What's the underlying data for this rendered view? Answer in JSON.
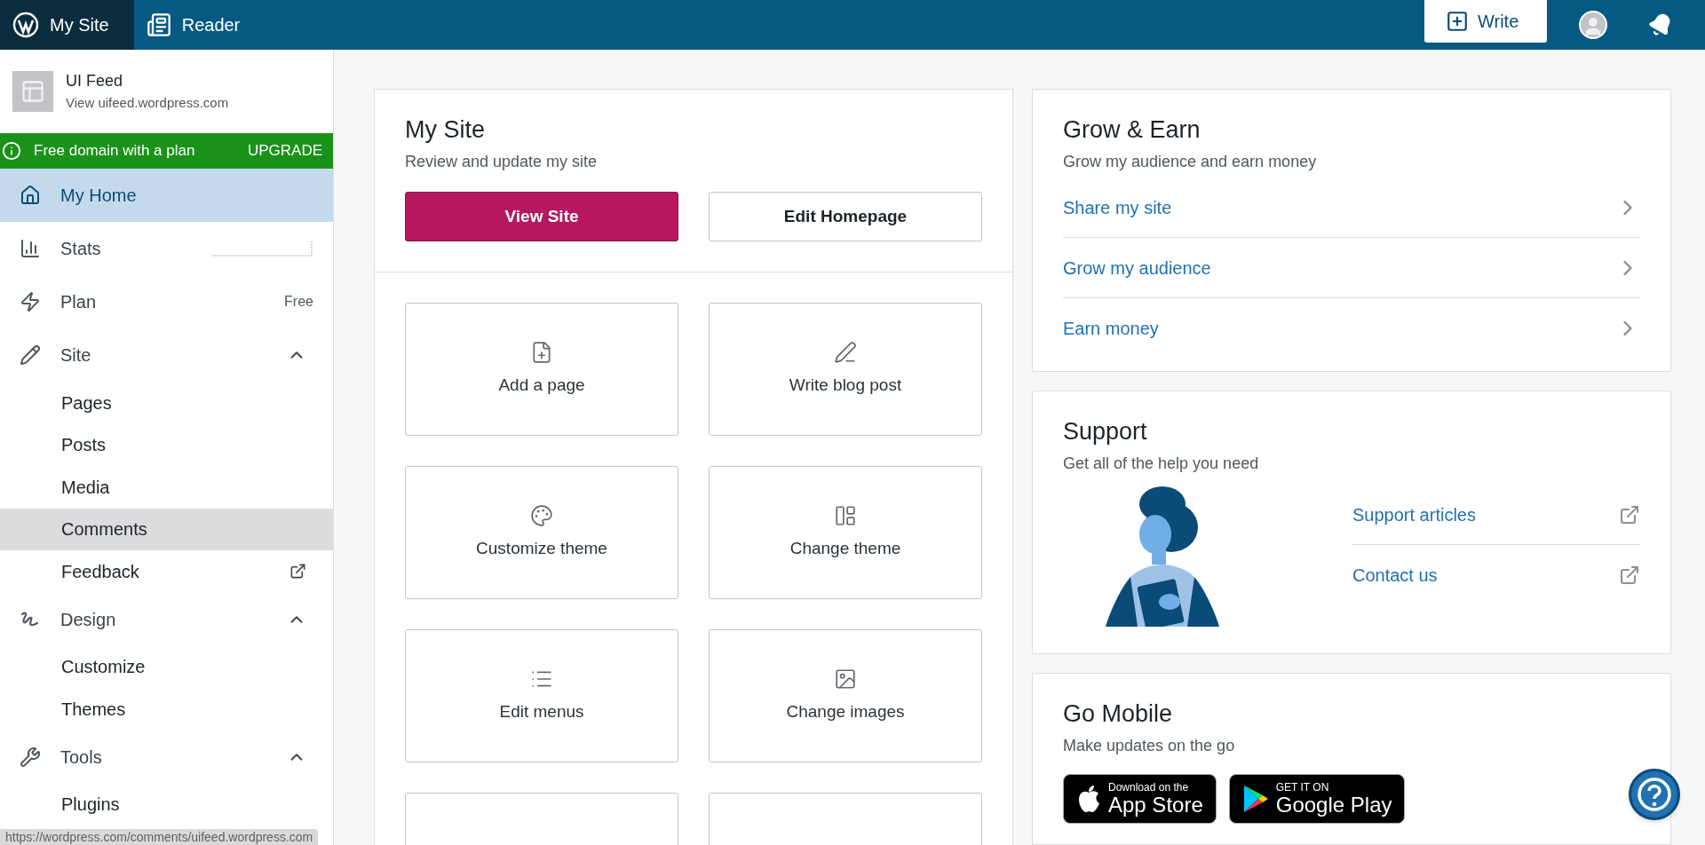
{
  "topbar": {
    "tabs": [
      {
        "label": "My Site",
        "selected": true,
        "kind": "logo"
      },
      {
        "label": "Reader",
        "selected": false,
        "kind": "reader"
      }
    ],
    "write_button": "Write"
  },
  "sidebar": {
    "site": {
      "name": "UI Feed",
      "url": "View uifeed.wordpress.com"
    },
    "banner": {
      "text": "Free domain with a plan",
      "action": "UPGRADE"
    },
    "items": [
      {
        "label": "My Home",
        "selected": true
      },
      {
        "label": "Stats",
        "selected": false
      },
      {
        "label": "Plan",
        "badge": "Free",
        "selected": false
      },
      {
        "label": "Site",
        "selected": false,
        "expanded": true,
        "children": [
          {
            "label": "Pages",
            "selected": false,
            "hovered": false
          },
          {
            "label": "Posts",
            "selected": false,
            "hovered": false
          },
          {
            "label": "Media",
            "selected": false,
            "hovered": false
          },
          {
            "label": "Comments",
            "selected": false,
            "hovered": true
          },
          {
            "label": "Feedback",
            "selected": false,
            "hovered": false,
            "external": true
          }
        ]
      },
      {
        "label": "Design",
        "selected": false,
        "expanded": true,
        "children": [
          {
            "label": "Customize",
            "selected": false,
            "hovered": false
          },
          {
            "label": "Themes",
            "selected": false,
            "hovered": false
          }
        ]
      },
      {
        "label": "Tools",
        "selected": false,
        "expanded": true,
        "children": [
          {
            "label": "Plugins",
            "selected": false,
            "hovered": false
          }
        ]
      }
    ]
  },
  "my_site": {
    "title": "My Site",
    "subtitle": "Review and update my site",
    "primary_button": "View Site",
    "secondary_button": "Edit Homepage",
    "quick_links": [
      {
        "label": "Add a page"
      },
      {
        "label": "Write blog post"
      },
      {
        "label": "Customize theme"
      },
      {
        "label": "Change theme"
      },
      {
        "label": "Edit menus"
      },
      {
        "label": "Change images"
      }
    ]
  },
  "grow": {
    "title": "Grow & Earn",
    "subtitle": "Grow my audience and earn money",
    "links": [
      "Share my site",
      "Grow my audience",
      "Earn money"
    ]
  },
  "support": {
    "title": "Support",
    "subtitle": "Get all of the help you need",
    "links": [
      "Support articles",
      "Contact us"
    ]
  },
  "mobile": {
    "title": "Go Mobile",
    "subtitle": "Make updates on the go",
    "badges": [
      {
        "kind": "apple",
        "small": "Download on the",
        "large": "App Store"
      },
      {
        "kind": "google",
        "small": "GET IT ON",
        "large": "Google Play"
      }
    ]
  },
  "status_url": "https://wordpress.com/comments/uifeed.wordpress.com"
}
